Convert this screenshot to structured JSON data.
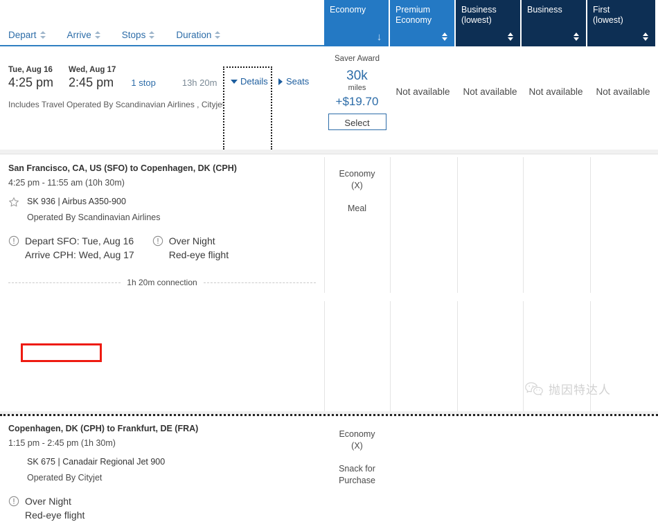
{
  "sort_headers": [
    {
      "label": "Depart",
      "icon": "sort-updown-icon"
    },
    {
      "label": "Arrive",
      "icon": "sort-updown-icon"
    },
    {
      "label": "Stops",
      "icon": "sort-updown-icon"
    },
    {
      "label": "Duration",
      "icon": "sort-updown-icon"
    }
  ],
  "cabin_tabs": [
    {
      "label": "Economy",
      "state": "active",
      "style": "light",
      "sort": "desc"
    },
    {
      "label": "Premium\nEconomy",
      "line1": "Premium",
      "line2": "Economy",
      "state": "inactive",
      "style": "light",
      "sort": "both"
    },
    {
      "label": "Business (lowest)",
      "line1": "Business",
      "line2": "(lowest)",
      "state": "inactive",
      "style": "dark",
      "sort": "both"
    },
    {
      "label": "Business",
      "line1": "Business",
      "line2": "",
      "state": "inactive",
      "style": "dark",
      "sort": "both"
    },
    {
      "label": "First (lowest)",
      "line1": "First",
      "line2": "(lowest)",
      "state": "inactive",
      "style": "dark",
      "sort": "both"
    }
  ],
  "flight_summary": {
    "depart_date": "Tue, Aug 16",
    "depart_time": "4:25 pm",
    "arrive_date": "Wed, Aug 17",
    "arrive_time": "2:45 pm",
    "stops": "1 stop",
    "duration": "13h 20m",
    "includes_note": "Includes Travel Operated By Scandinavian Airlines , Cityjet",
    "details_label": "Details",
    "seats_label": "Seats"
  },
  "fares": [
    {
      "available": true,
      "award_type": "Saver Award",
      "miles": "30k",
      "miles_unit": "miles",
      "cash": "+$19.70",
      "select_label": "Select"
    },
    {
      "available": false,
      "unavailable_text": "Not available"
    },
    {
      "available": false,
      "unavailable_text": "Not available"
    },
    {
      "available": false,
      "unavailable_text": "Not available"
    },
    {
      "available": false,
      "unavailable_text": "Not available"
    }
  ],
  "segments": [
    {
      "route": "San Francisco, CA, US (SFO) to Copenhagen, DK (CPH)",
      "times": "4:25 pm - 11:55 am (10h 30m)",
      "flight_number": "SK 936 | Airbus A350-900",
      "operated_by": "Operated By Scandinavian Airlines",
      "has_star": true,
      "notes": [
        {
          "line1": "Depart SFO: Tue, Aug 16",
          "line2": "Arrive CPH: Wed, Aug 17",
          "icon": "exclamation-circle-icon"
        },
        {
          "line1": "Over Night",
          "line2": "Red-eye flight",
          "icon": "exclamation-circle-icon"
        }
      ],
      "cabin": "Economy",
      "cabin_code": "(X)",
      "meal": "Meal"
    },
    {
      "route": "Copenhagen, DK (CPH) to Frankfurt, DE (FRA)",
      "times": "1:15 pm - 2:45 pm (1h 30m)",
      "flight_number": "SK 675 | Canadair Regional Jet 900",
      "operated_by": "Operated By Cityjet",
      "has_star": false,
      "highlighted": true,
      "notes": [
        {
          "line1": "Over Night",
          "line2": "Red-eye flight",
          "icon": "exclamation-circle-icon"
        }
      ],
      "cabin": "Economy",
      "cabin_code": "(X)",
      "meal_line1": "Snack for",
      "meal_line2": "Purchase"
    }
  ],
  "connection": {
    "text": "1h 20m connection"
  },
  "watermark": {
    "text": "抛因特达人",
    "logo": "wechat-logo-icon"
  },
  "colors": {
    "tab_light": "#2479c4",
    "tab_dark": "#0d2f54",
    "link_blue": "#2c6ca8",
    "annotation_red": "#ee1b11"
  }
}
